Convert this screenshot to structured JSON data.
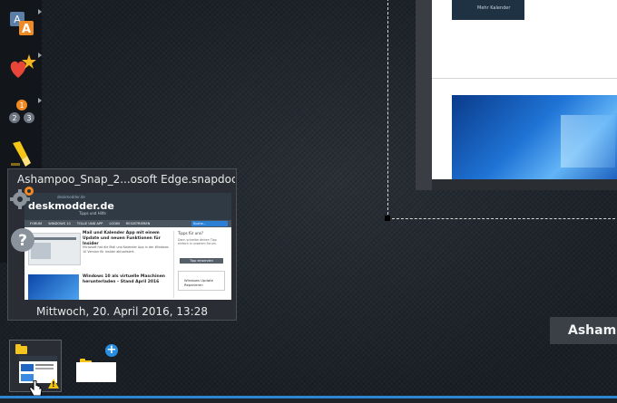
{
  "toolbar": {
    "items": [
      {
        "icon": "text-style-icon",
        "text": "A"
      },
      {
        "icon": "favorites-heart-star-icon"
      },
      {
        "icon": "numbering-badges-icon",
        "badges": [
          "1",
          "2",
          "3"
        ]
      },
      {
        "icon": "highlighter-icon"
      },
      {
        "icon": "settings-gear-icon"
      },
      {
        "icon": "help-icon",
        "text": "?"
      }
    ]
  },
  "popup": {
    "title": "Ashampoo_Snap_2...osoft Edge.snapdoc",
    "date": "Mittwoch, 20. April 2016, 13:28",
    "screenshot": {
      "url": "deskmodder.de",
      "logo": "deskmodder.de",
      "subtitle": "Tipps und Hilfe",
      "nav": [
        "FORUM",
        "WINDOWS 10",
        "TOLLE UND APP",
        "LOGIN",
        "REGISTRIEREN"
      ],
      "search": "Suche...",
      "article1_title": "Mail und Kalender App mit einem Update und neuen Funktionen für Insider",
      "article1_text": "Microsoft hat die Mail und Kalender App in der Windows 10 Version für Insider aktualisiert.",
      "article2_title": "Windows 10 als virtuelle Maschinen herunterladen – Stand April 2016",
      "side_title": "Tipps für uns?",
      "side_text": "Dann schreibe deinen Tipp einfach in unserem Forum.",
      "side_button": "Tipp einsenden",
      "side_ad": "Windows Update Reparieren"
    }
  },
  "preview_card": {
    "thumb_label": "Mehr Kalender"
  },
  "brand_label": "Ashamp",
  "colors": {
    "accent": "#2b86d6",
    "background": "#1c222a",
    "warning": "#f1c40f",
    "folder": "#f4c51f"
  }
}
